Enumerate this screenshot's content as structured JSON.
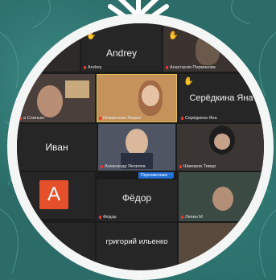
{
  "tiles": {
    "andrey": {
      "big_name": "Andrey",
      "label": "Andrey"
    },
    "permyakova": {
      "label": "Анастасия Пермякова"
    },
    "slinko": {
      "label": "а Слинько"
    },
    "ismailova": {
      "label": "Исмаилова Мария"
    },
    "seryodkina": {
      "big_name": "Серёдкина Яна",
      "label": "Серёдкина Яна"
    },
    "ivan": {
      "big_name": "Иван"
    },
    "yakovlev": {
      "label": "Александр Яковлев"
    },
    "shavyrov": {
      "label": "Шаворов Тимур"
    },
    "fedor": {
      "big_name": "Фёдор",
      "label": "Фёдор"
    },
    "lipin": {
      "label": "Липин М"
    },
    "grigoriy": {
      "big_name": "григорий ильенко"
    },
    "avatar_letter": "A"
  },
  "controls": {
    "rename_button": "Переименовать",
    "more_button": "···"
  },
  "colors": {
    "background": "#2b6c68",
    "ring": "#f4f6f5",
    "tile": "#262626",
    "avatar": "#e5502a",
    "accent": "#1f6ed4",
    "active_speaker": "#e0c04a"
  },
  "icons": [
    "snowflake-icon",
    "raised-hand-icon",
    "muted-mic-icon"
  ]
}
